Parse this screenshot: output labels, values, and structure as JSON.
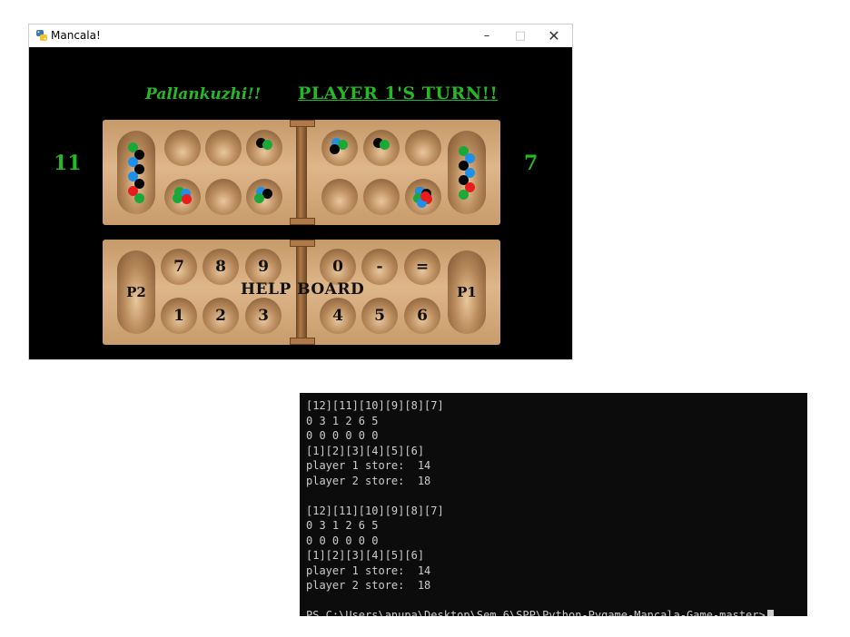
{
  "window": {
    "title": "Mancala!",
    "controls": {
      "minimize": "–",
      "maximize": "□",
      "close": "✕"
    },
    "icon": "python-icon"
  },
  "game": {
    "name": "Pallankuzhi!!",
    "turn": "PLAYER 1'S TURN!!",
    "score_left": "11",
    "score_right": "7",
    "text_color": "#25b925"
  },
  "board": {
    "stone_colors": {
      "g": "#1aa838",
      "b": "#1e90e8",
      "k": "#050505",
      "r": "#e81c1c"
    },
    "left_store": [
      "g",
      "k",
      "b",
      "k",
      "b",
      "k",
      "r",
      "g"
    ],
    "right_store": [
      "g",
      "b",
      "k",
      "b",
      "k",
      "r",
      "g"
    ],
    "top_row": [
      [],
      [],
      [],
      [
        "k",
        "g"
      ],
      [
        "b",
        "g",
        "k"
      ],
      [
        "k",
        "g"
      ],
      [],
      []
    ],
    "bottom_row": [
      [
        "g",
        "b",
        "g",
        "r"
      ],
      [],
      [],
      [
        "b",
        "k",
        "g"
      ],
      [],
      [],
      [
        "k",
        "g"
      ],
      [
        "b",
        "k",
        "g",
        "r",
        "b",
        "r"
      ]
    ]
  },
  "help_board": {
    "title": "HELP BOARD",
    "left_store": "P2",
    "right_store": "P1",
    "top_keys": [
      "7",
      "8",
      "9",
      "0",
      "-",
      "="
    ],
    "bottom_keys": [
      "1",
      "2",
      "3",
      "4",
      "5",
      "6"
    ]
  },
  "terminal": {
    "lines": [
      "[12][11][10][9][8][7]",
      "0 3 1 2 6 5",
      "0 0 0 0 0 0",
      "[1][2][3][4][5][6]",
      "player 1 store:  14",
      "player 2 store:  18",
      "",
      "[12][11][10][9][8][7]",
      "0 3 1 2 6 5",
      "0 0 0 0 0 0",
      "[1][2][3][4][5][6]",
      "player 1 store:  14",
      "player 2 store:  18",
      "",
      "PS C:\\Users\\anupa\\Desktop\\Sem 6\\SPP\\Python-Pygame-Mancala-Game-master>"
    ]
  }
}
